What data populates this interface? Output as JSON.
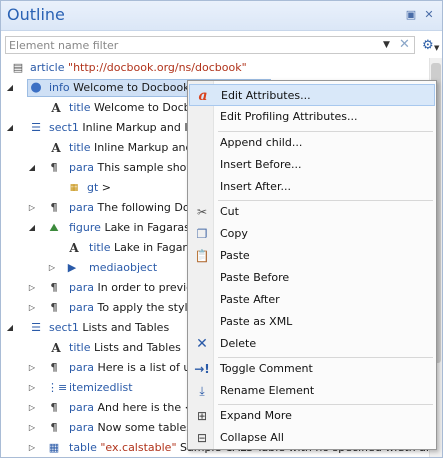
{
  "panel": {
    "title": "Outline",
    "restore_icon": "restore-icon",
    "close_icon": "close-icon"
  },
  "filter": {
    "placeholder": "Element name filter",
    "value": ""
  },
  "tree": {
    "rows": [
      {
        "el": "article",
        "attr": "\"http://docbook.org/ns/docbook\""
      },
      {
        "el": "info",
        "text": "Welcome to Docbook Su"
      },
      {
        "el": "title",
        "text": "Welcome to Docboo"
      },
      {
        "el": "sect1",
        "text": "Inline Markup and Ima"
      },
      {
        "el": "title",
        "text": "Inline Markup and In"
      },
      {
        "el": "para",
        "text": "This sample shows"
      },
      {
        "el": "gt",
        "text": ">"
      },
      {
        "el": "para",
        "text": "The following Docb"
      },
      {
        "el": "figure",
        "text": "Lake in Fagaras"
      },
      {
        "el": "title",
        "text": "Lake in Fagaras"
      },
      {
        "el": "mediaobject",
        "text": ""
      },
      {
        "el": "para",
        "text": "In order to preview"
      },
      {
        "el": "para",
        "text": "To apply the styles"
      },
      {
        "el": "sect1",
        "text": "Lists and Tables"
      },
      {
        "el": "title",
        "text": "Lists and Tables"
      },
      {
        "el": "para",
        "text": "Here is a list of use"
      },
      {
        "el": "itemizedlist",
        "text": ""
      },
      {
        "el": "para",
        "text": "And here is the <o"
      },
      {
        "el": "para",
        "text": "Now some tables. T"
      },
      {
        "el": "table",
        "attr": "\"ex.calstable\"",
        "text": "Sample CALS Table with no specified width and propo"
      }
    ]
  },
  "menu": {
    "edit_attributes": "Edit Attributes...",
    "edit_profiling": "Edit Profiling Attributes...",
    "append_child": "Append child...",
    "insert_before": "Insert Before...",
    "insert_after": "Insert After...",
    "cut": "Cut",
    "copy": "Copy",
    "paste": "Paste",
    "paste_before": "Paste Before",
    "paste_after": "Paste After",
    "paste_as_xml": "Paste as XML",
    "delete": "Delete",
    "toggle_comment": "Toggle Comment",
    "rename_element": "Rename Element",
    "expand_more": "Expand More",
    "collapse_all": "Collapse All"
  },
  "colors": {
    "title": "#2a62b4",
    "element": "#2a5aa8",
    "attribute": "#b0321a",
    "selection": "#cfe0f5",
    "menu_highlight": "#d9e8f9"
  }
}
